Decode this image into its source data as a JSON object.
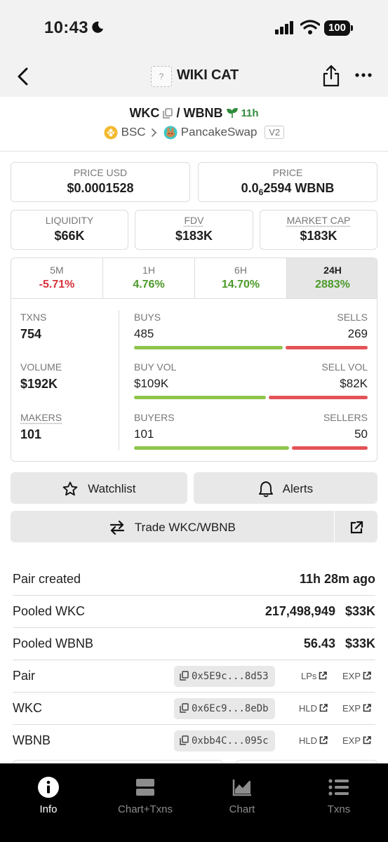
{
  "status_bar": {
    "time": "10:43",
    "battery": "100"
  },
  "nav": {
    "token_thumb": "?",
    "title": "WIKI CAT"
  },
  "pair": {
    "base": "WKC",
    "separator": "/",
    "quote": "WBNB",
    "age": "11h",
    "chain": "BSC",
    "dex": "PancakeSwap",
    "version": "V2"
  },
  "cards": {
    "price_usd": {
      "label": "PRICE USD",
      "value": "$0.0001528"
    },
    "price": {
      "label": "PRICE",
      "prefix": "0.0",
      "subscript": "6",
      "value": "2594 WBNB"
    },
    "liquidity": {
      "label": "LIQUIDITY",
      "value": "$66K"
    },
    "fdv": {
      "label": "FDV",
      "value": "$183K"
    },
    "market_cap": {
      "label": "MARKET CAP",
      "value": "$183K"
    }
  },
  "timeframes": [
    {
      "label": "5M",
      "change": "-5.71%"
    },
    {
      "label": "1H",
      "change": "4.76%"
    },
    {
      "label": "6H",
      "change": "14.70%"
    },
    {
      "label": "24H",
      "change": "2883%"
    }
  ],
  "stats": {
    "txns": {
      "label": "TXNS",
      "value": "754"
    },
    "volume": {
      "label": "VOLUME",
      "value": "$192K"
    },
    "makers": {
      "label": "MAKERS",
      "value": "101"
    },
    "buys": {
      "label": "BUYS",
      "value": "485",
      "ratio": 0.643
    },
    "sells": {
      "label": "SELLS",
      "value": "269"
    },
    "buy_vol": {
      "label": "BUY VOL",
      "value": "$109K",
      "ratio": 0.57
    },
    "sell_vol": {
      "label": "SELL VOL",
      "value": "$82K"
    },
    "buyers": {
      "label": "BUYERS",
      "value": "101",
      "ratio": 0.669
    },
    "sellers": {
      "label": "SELLERS",
      "value": "50"
    }
  },
  "actions": {
    "watchlist": "Watchlist",
    "alerts": "Alerts",
    "trade": "Trade WKC/WBNB"
  },
  "info": {
    "pair_created": {
      "label": "Pair created",
      "value": "11h 28m ago"
    },
    "pooled_wkc": {
      "label": "Pooled WKC",
      "amount": "217,498,949",
      "usd": "$33K"
    },
    "pooled_wbnb": {
      "label": "Pooled WBNB",
      "amount": "56.43",
      "usd": "$33K"
    },
    "pair_addr": {
      "label": "Pair",
      "address": "0x5E9c...8d53",
      "link1": "LPs",
      "link2": "EXP"
    },
    "wkc_addr": {
      "label": "WKC",
      "address": "0x6Ec9...8eDb",
      "link1": "HLD",
      "link2": "EXP"
    },
    "wbnb_addr": {
      "label": "WBNB",
      "address": "0xbb4C...095c",
      "link1": "HLD",
      "link2": "EXP"
    }
  },
  "tabbar": [
    {
      "label": "Info",
      "icon": "info-icon",
      "active": true
    },
    {
      "label": "Chart+Txns",
      "icon": "chart-txns-icon"
    },
    {
      "label": "Chart",
      "icon": "chart-icon"
    },
    {
      "label": "Txns",
      "icon": "list-icon"
    }
  ],
  "colors": {
    "positive": "#4c9a2a",
    "negative": "#d6343c",
    "buy_bar": "#8fc54a",
    "sell_bar": "#e45358"
  }
}
